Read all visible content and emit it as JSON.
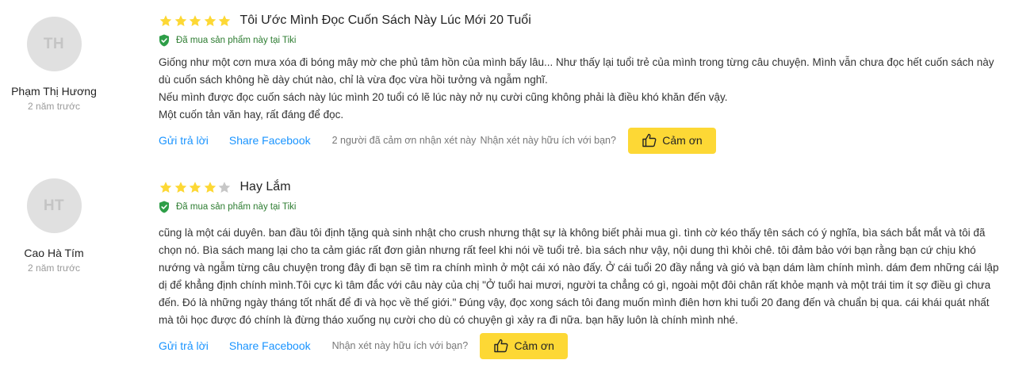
{
  "reviews": [
    {
      "avatar_initials": "TH",
      "user_name": "Phạm Thị Hương",
      "date": "2 năm trước",
      "rating": 5,
      "title": "Tôi Ước Mình Đọc Cuốn Sách Này Lúc Mới 20 Tuổi",
      "bought_label": "Đã mua sản phẩm này tại Tiki",
      "lines": [
        "Giống như một cơn mưa xóa đi bóng mây mờ che phủ tâm hồn của mình bấy lâu... Như thấy lại tuổi trẻ của mình trong từng câu chuyện. Mình vẫn chưa đọc hết cuốn sách này dù cuốn sách không hề dày chút nào, chỉ là vừa đọc vừa hồi tưởng và ngẫm nghĩ.",
        "Nếu mình được đọc cuốn sách này lúc mình 20 tuổi có lẽ lúc này nở nụ cười cũng không phải là điều khó khăn đến vậy.",
        "Một cuốn tản văn hay, rất đáng để đọc."
      ],
      "reply_label": "Gửi trả lời",
      "share_label": "Share Facebook",
      "thanks_count_text": "2 người đã cảm ơn nhận xét này",
      "helpful_text": "Nhận xét này hữu ích với bạn?",
      "thanks_label": "Cảm ơn"
    },
    {
      "avatar_initials": "HT",
      "user_name": "Cao Hà Tím",
      "date": "2 năm trước",
      "rating": 4,
      "title": "Hay Lắm",
      "bought_label": "Đã mua sản phẩm này tại Tiki",
      "lines": [
        "cũng là một cái duyên. ban đầu tôi định tặng quà sinh nhật cho crush nhưng thật sự là không biết phải mua gì. tình cờ kéo thấy tên sách có ý nghĩa, bìa sách bắt mắt và tôi đã chọn nó. Bìa sách mang lại cho ta cảm giác rất đơn giản nhưng rất feel khi nói về tuổi trẻ. bìa sách như vậy, nội dung thì khỏi chê. tôi đảm bảo với bạn rằng bạn cứ chịu khó nướng và ngẫm từng câu chuyện trong đây đi bạn sẽ tìm ra chính mình ở một cái xó nào đấy. Ở cái tuổi 20 đầy nắng và gió và bạn dám làm chính mình. dám đem những cái lập dị để khẳng định chính mình.Tôi cực kì tâm đắc với câu này của chị \"Ở tuổi hai mươi, người ta chẳng có gì, ngoài một đôi chân rất khỏe mạnh và một trái tim ít sợ điều gì chưa đến. Đó là những ngày tháng tốt nhất để đi và học về thế giới.\" Đúng vậy, đọc xong sách tôi đang muốn mình điên hơn khi tuổi 20 đang đến và chuẩn bị qua. cái khái quát nhất mà tôi học được đó chính là đừng tháo xuống nụ cười cho dù có chuyện gì xảy ra đi nữa. bạn hãy luôn là chính mình nhé."
      ],
      "reply_label": "Gửi trả lời",
      "share_label": "Share Facebook",
      "helpful_text": "Nhận xét này hữu ích với bạn?",
      "thanks_label": "Cảm ơn"
    }
  ],
  "colors": {
    "star_filled": "#fdd835",
    "star_empty": "#c7c7c7",
    "link": "#1a94ff",
    "bought": "#2e7d32",
    "thanks_button": "#fdd835"
  },
  "icons": {
    "star": "star-icon",
    "bought": "shield-check-icon",
    "thanks": "thumbs-up-icon"
  }
}
